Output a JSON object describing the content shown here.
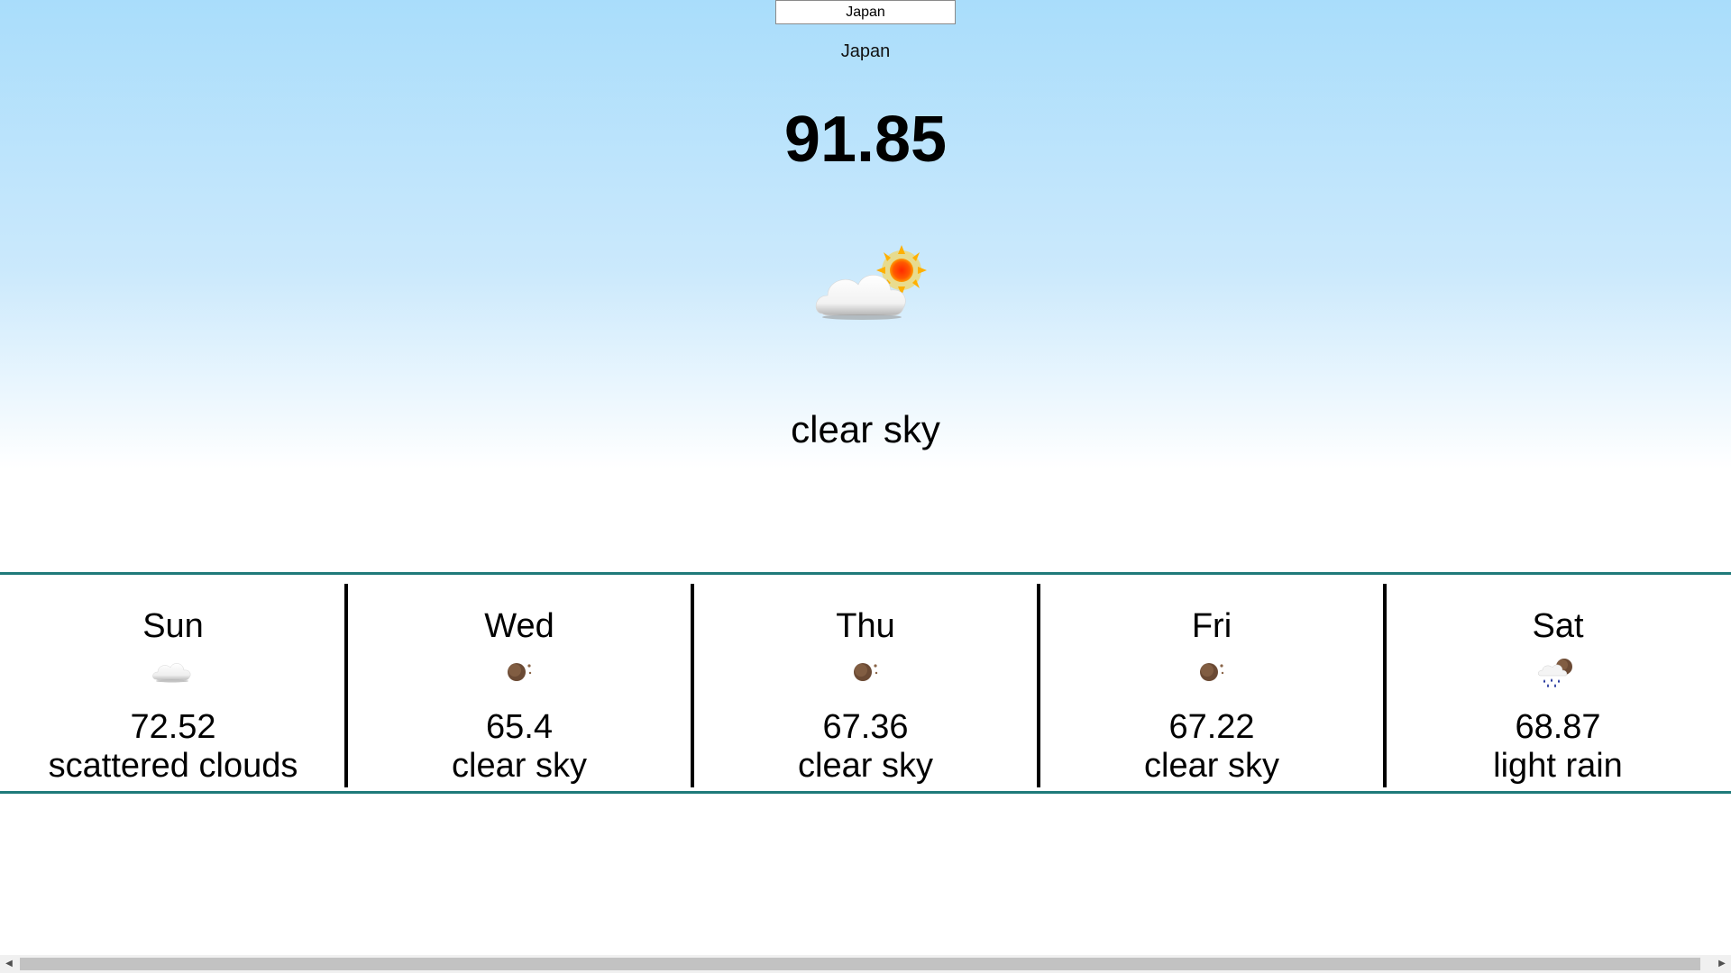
{
  "search": {
    "value": "Japan"
  },
  "current": {
    "location": "Japan",
    "temperature": "91.85",
    "description": "clear sky",
    "icon": "partly-cloudy-day-icon"
  },
  "forecast": [
    {
      "day": "Sun",
      "temp": "72.52",
      "desc": "scattered clouds",
      "icon": "cloud-icon"
    },
    {
      "day": "Wed",
      "temp": "65.4",
      "desc": "clear sky",
      "icon": "night-clear-icon"
    },
    {
      "day": "Thu",
      "temp": "67.36",
      "desc": "clear sky",
      "icon": "night-clear-icon"
    },
    {
      "day": "Fri",
      "temp": "67.22",
      "desc": "clear sky",
      "icon": "night-clear-icon"
    },
    {
      "day": "Sat",
      "temp": "68.87",
      "desc": "light rain",
      "icon": "night-rain-icon"
    }
  ],
  "colors": {
    "divider_accent": "#1f7a7a",
    "sky_top": "#a9ddfb",
    "sky_bottom": "#ffffff"
  }
}
